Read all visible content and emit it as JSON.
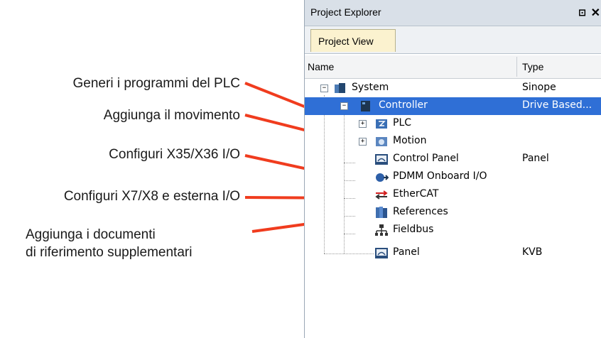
{
  "callouts": [
    "Generi i programmi del PLC",
    "Aggiunga il movimento",
    "Configuri X35/X36 I/O",
    "Configuri X7/X8 e esterna I/O",
    "Aggiunga i documenti",
    "di riferimento supplementari"
  ],
  "explorer": {
    "title": "Project Explorer",
    "pin_glyph": "⊡",
    "close_glyph": "✕",
    "tab": "Project View",
    "col_name": "Name",
    "col_type": "Type",
    "rows": [
      {
        "label": "System",
        "type": "Sinope"
      },
      {
        "label": "Controller",
        "type": "Drive Based..."
      },
      {
        "label": "PLC",
        "type": ""
      },
      {
        "label": "Motion",
        "type": ""
      },
      {
        "label": "Control Panel",
        "type": "Panel"
      },
      {
        "label": "PDMM Onboard I/O",
        "type": ""
      },
      {
        "label": "EtherCAT",
        "type": ""
      },
      {
        "label": "References",
        "type": ""
      },
      {
        "label": "Fieldbus",
        "type": ""
      },
      {
        "label": "Panel",
        "type": "KVB"
      }
    ],
    "expander_minus": "−",
    "expander_plus": "+"
  },
  "colors": {
    "arrow": "#f03c1e",
    "selection": "#2f6fd6"
  }
}
